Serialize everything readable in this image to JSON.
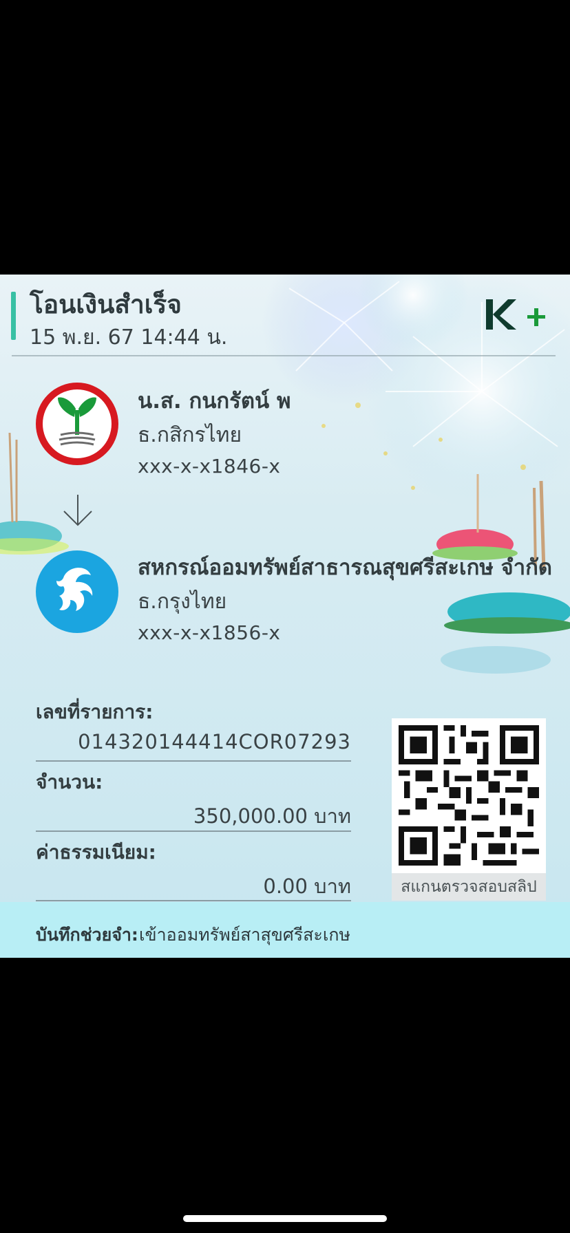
{
  "header": {
    "title": "โอนเงินสำเร็จ",
    "datetime": "15 พ.ย. 67  14:44 น.",
    "brand_logo": "K+",
    "accent_color": "#38c0a4",
    "brand_color": "#1a9a3a"
  },
  "sender": {
    "name": "น.ส. กนกรัตน์ พ",
    "bank": "ธ.กสิกรไทย",
    "account": "xxx-x-x1846-x",
    "logo_icon": "kasikorn-bank-logo",
    "logo_color": "#d71920"
  },
  "transfer_arrow_icon": "arrow-down-icon",
  "receiver": {
    "name": "สหกรณ์ออมทรัพย์สาธารณสุขศรีสะเกษ จำกัด",
    "bank": "ธ.กรุงไทย",
    "account": "xxx-x-x1856-x",
    "logo_icon": "krungthai-bank-logo",
    "logo_color": "#1ba5e0"
  },
  "details": {
    "ref_label": "เลขที่รายการ:",
    "ref_value": "014320144414COR07293",
    "amount_label": "จำนวน:",
    "amount_value": "350,000.00 บาท",
    "fee_label": "ค่าธรรมเนียม:",
    "fee_value": "0.00 บาท"
  },
  "qr": {
    "icon": "qr-code-icon",
    "caption": "สแกนตรวจสอบสลิป"
  },
  "memo": {
    "label": "บันทึกช่วยจำ:",
    "text": "เข้าออมทรัพย์สาสุขศรีสะเกษ"
  }
}
